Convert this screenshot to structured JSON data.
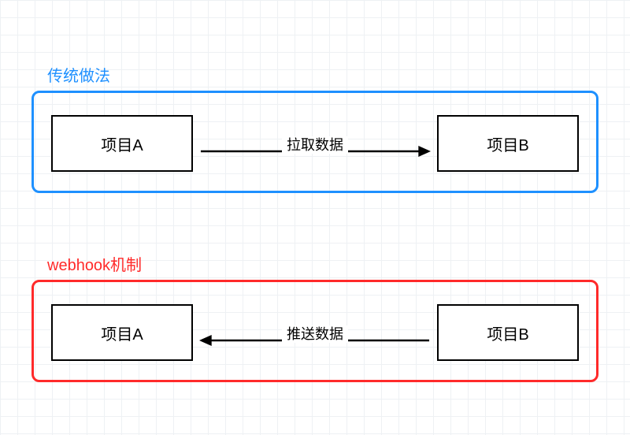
{
  "sections": [
    {
      "title": "传统做法",
      "color": "#1e90ff",
      "left_node": "项目A",
      "right_node": "项目B",
      "arrow_label": "拉取数据",
      "arrow_direction": "right"
    },
    {
      "title": "webhook机制",
      "color": "#ff2a2a",
      "left_node": "项目A",
      "right_node": "项目B",
      "arrow_label": "推送数据",
      "arrow_direction": "left"
    }
  ]
}
